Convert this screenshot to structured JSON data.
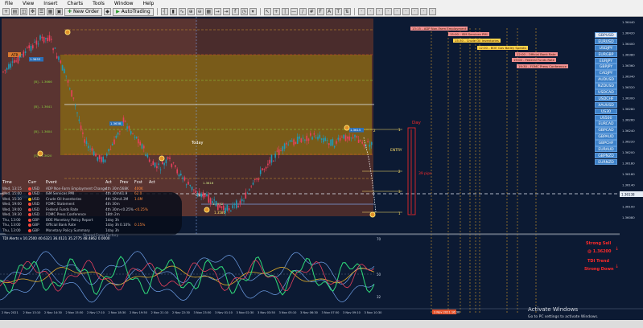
{
  "menu": [
    "File",
    "View",
    "Insert",
    "Charts",
    "Tools",
    "Window",
    "Help"
  ],
  "toolbar": {
    "new_order": "New Order",
    "autotrading": "AutoTrading"
  },
  "chart": {
    "center_label": "Today",
    "day_label": "Day",
    "pip_label": "39 pips",
    "entry_label": "ENTRY",
    "open_label": "Open",
    "atr_label": "ATR",
    "level_labels": [
      "1.3653",
      "1.3638",
      "1.3615",
      "1.3604"
    ],
    "mid_levels": [
      "[B] - 1.3666",
      "[B] - 1.3641",
      "[B] - 1.3604",
      "[S] - 1.3620"
    ],
    "box_values": [
      "1.3616",
      "1.3592"
    ],
    "low_tag": "1.3586",
    "fib_marks": [
      "1",
      "2",
      "3",
      "1",
      "2",
      "3"
    ],
    "price_axis": [
      "1.36440",
      "1.36420",
      "1.36400",
      "1.36380",
      "1.36360",
      "1.36340",
      "1.36320",
      "1.36300",
      "1.36280",
      "1.36260",
      "1.36240",
      "1.36220",
      "1.36200",
      "1.36180",
      "1.36160",
      "1.36140",
      "1.36120",
      "1.36100",
      "1.36080"
    ],
    "price_tags": [
      "1.36337",
      "1.36138"
    ],
    "time_axis": [
      "2 Nov 2021",
      "2 Nov 13:10",
      "2 Nov 14:30",
      "2 Nov 15:50",
      "2 Nov 17:10",
      "2 Nov 18:30",
      "2 Nov 19:50",
      "2 Nov 21:10",
      "2 Nov 22:30",
      "3 Nov 23:50",
      "3 Nov 01:10",
      "3 Nov 02:30",
      "3 Nov 03:50",
      "3 Nov 05:10",
      "3 Nov 06:30",
      "3 Nov 07:50",
      "3 Nov 09:10",
      "3 Nov 10:30"
    ],
    "time_tag": "3 Nov 2021 16:30"
  },
  "news_tags": [
    {
      "text": "13:15 - ADP Non-Farm Employment",
      "color": "#f29191"
    },
    {
      "text": "15:00 - ISM Services PMI",
      "color": "#f29191"
    },
    {
      "text": "15:30 - Crude Oil Inventories",
      "color": "#ffd34a"
    },
    {
      "text": "12:00 - BOE Gov Bailey Speaks",
      "color": "#ffd34a"
    },
    {
      "text": "12:00 - Official Bank Rate",
      "color": "#f29191"
    },
    {
      "text": "19:00 - Federal Funds Rate",
      "color": "#f29191"
    },
    {
      "text": "19:30 - FOMC Press Conference",
      "color": "#f29191"
    }
  ],
  "news_table": {
    "headers": [
      "Time",
      "Curr",
      "Event",
      "Act",
      "Prev",
      "Fcst",
      "Act"
    ],
    "rows": [
      {
        "time": "Wed, 13:15",
        "curr": "USD",
        "event": "ADP Non-Farm Employment Change",
        "act": "4th 30m",
        "prev": "568K",
        "fcst": "400K",
        "dot": "#ff4a3d"
      },
      {
        "time": "Wed, 15:00",
        "curr": "USD",
        "event": "ISM Services PMI",
        "act": "4th 30m",
        "prev": "61.9",
        "fcst": "62.0",
        "dot": "#ff4a3d"
      },
      {
        "time": "Wed, 15:30",
        "curr": "USD",
        "event": "Crude Oil Inventories",
        "act": "4th 30m",
        "prev": "4.3M",
        "fcst": "1.6M",
        "dot": "#ffb400"
      },
      {
        "time": "Wed, 19:00",
        "curr": "USD",
        "event": "FOMC Statement",
        "act": "4th 30m",
        "prev": "",
        "fcst": "",
        "dot": "#ff4a3d"
      },
      {
        "time": "Wed, 19:00",
        "curr": "USD",
        "event": "Federal Funds Rate",
        "act": "4th 30m",
        "prev": "<0.25%",
        "fcst": "<0.25%",
        "dot": "#ff4a3d"
      },
      {
        "time": "Wed, 19:30",
        "curr": "USD",
        "event": "FOMC Press Conference",
        "act": "18th 2m",
        "prev": "",
        "fcst": "",
        "dot": "#ff4a3d"
      },
      {
        "time": "Thu, 13:00",
        "curr": "GBP",
        "event": "BOE Monetary Policy Report",
        "act": "1day 3h",
        "prev": "",
        "fcst": "",
        "dot": "#ff4a3d"
      },
      {
        "time": "Thu, 13:00",
        "curr": "GBP",
        "event": "Official Bank Rate",
        "act": "1day 3h",
        "prev": "0.10%",
        "fcst": "0.15%",
        "dot": "#ff4a3d"
      },
      {
        "time": "Thu, 13:00",
        "curr": "GBP",
        "event": "Monetary Policy Summary",
        "act": "1day 3h",
        "prev": "",
        "fcst": "",
        "dot": "#ff4a3d"
      }
    ],
    "footer": "Shared Forex Factory"
  },
  "symbols": [
    "GBPUSD",
    "EURUSD",
    "USDJPY",
    "EURGBP",
    "EURJPY",
    "GBPJPY",
    "CADJPY",
    "AUDUSD",
    "NZDUSD",
    "USDCAD",
    "USDCHF",
    "XAUUSD",
    "US30",
    "US500",
    "EURCAD",
    "GBPCAD",
    "GBPAUD",
    "GBPCHF",
    "EURAUD",
    "GBPNZD",
    "EURNZD"
  ],
  "selected_symbol": "GBPUSD",
  "indicator": {
    "title": "TDI Alerts v 10.2500 40.6321 36.0121 35.2775 48.4862 0.0000",
    "scale": [
      "70",
      "50",
      "32"
    ],
    "signal_lines": [
      "Strong Sell",
      "@ 1.36200",
      "TDI Trend",
      "Strong Down"
    ]
  },
  "watermark": [
    "Activate Windows",
    "Go to PC settings to activate Windows."
  ],
  "colors": {
    "bg": "#0c1a33",
    "zone_brown": "#5a3431",
    "zone_orange": "#8a6b13",
    "candle_up": "#1e9bb8",
    "candle_down": "#e8405d",
    "signal": "#ff2a2a"
  }
}
